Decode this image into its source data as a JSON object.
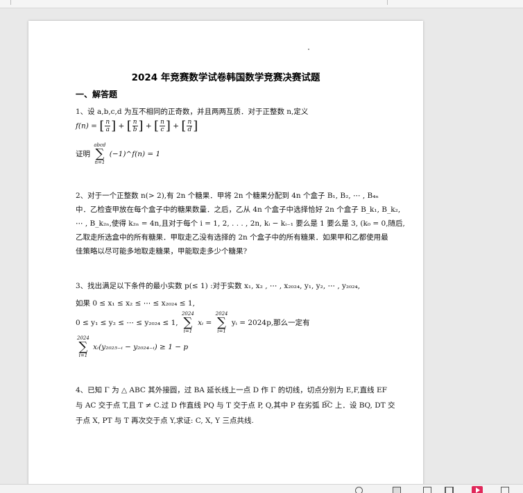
{
  "document": {
    "title": "2024 年竞赛数学试卷韩国数学竞赛决赛试题",
    "section": "一、解答题",
    "q1": {
      "intro": "1、设 a,b,c,d 为互不相同的正奇数，并且两两互质．对于正整数 n,定义",
      "f_lhs": "f(n) =",
      "frac_num": "n",
      "frac_dens": [
        "a",
        "b",
        "c",
        "d"
      ],
      "plus": "+",
      "prove_label": "证明",
      "sum_upper": "abcd",
      "sum_lower": "n=1",
      "prove_expr": "(−1)^f(n) = 1"
    },
    "q2": {
      "l1": "2、对于一个正整数 n(> 2),有 2n 个糖果．甲将 2n 个糖果分配到 4n 个盒子  B₁, B₂, ⋯ , B₄ₙ",
      "l2": "中．乙检查甲放在每个盒子中的糖果数量．之后，乙从 4n 个盒子中选择恰好 2n 个盒子 B_k₁, B_k₂,",
      "l3": "⋯ , B_k₂ₙ,使得 k₂ₙ = 4n,且对于每个 i = 1, 2, . . . , 2n, kᵢ − kᵢ₋₁ 要么是 1 要么是 3, (k₀ = 0,随后,",
      "l4": "乙取走所选盒中的所有糖果．甲取走乙没有选择的 2n 个盒子中的所有糖果．如果甲和乙都使用最",
      "l5": "佳策略以尽可能多地取走糖果，甲能取走多少个糖果?"
    },
    "q3": {
      "l1": "3、找出满足以下条件的最小实数 p(≤ 1) :对于实数  x₁,  x₂ , ⋯ ,  x₂₀₂₄,  y₁, y₂, ⋯ , y₂₀₂₄,",
      "l2": "如果  0 ≤ x₁ ≤ x₂ ≤ ⋯ ≤ x₂₀₂₄ ≤ 1,",
      "l3_a": "0 ≤ y₁ ≤ y₂ ≤ ⋯ ≤ y₂₀₂₄ ≤ 1,",
      "l3_b": "xᵢ =",
      "l3_c": "yᵢ = 2024p,那么一定有",
      "sum_upper": "2024",
      "sum_lower": "i=1",
      "l4": "xᵢ(y₂₀₂₅₋ᵢ − y₂₀₂₄₋ᵢ) ≥ 1 − p"
    },
    "q4": {
      "l1": "4、已知 Γ 为 △ ABC 其外接圆，过 BA 延长线上一点 D 作 Γ 的切线，切点分别为 E,F,直线 EF",
      "l2": "与 AC 交于点 T,且 T ≠ C.过 D 作直线 PQ 与 T 交于点 P, Q,其中 P 在劣弧 B͡C 上．设 BQ, DT 交",
      "l3": "于点 X, PT 与 T 再次交于点 Y,求证: C, X, Y 三点共线."
    }
  },
  "statusbar": {
    "zoom_icon": "zoom-icon",
    "icons": [
      "single-page-icon",
      "continuous-page-icon",
      "two-page-icon",
      "play-slideshow-icon",
      "fullscreen-icon"
    ],
    "accent": "#e0285a"
  }
}
